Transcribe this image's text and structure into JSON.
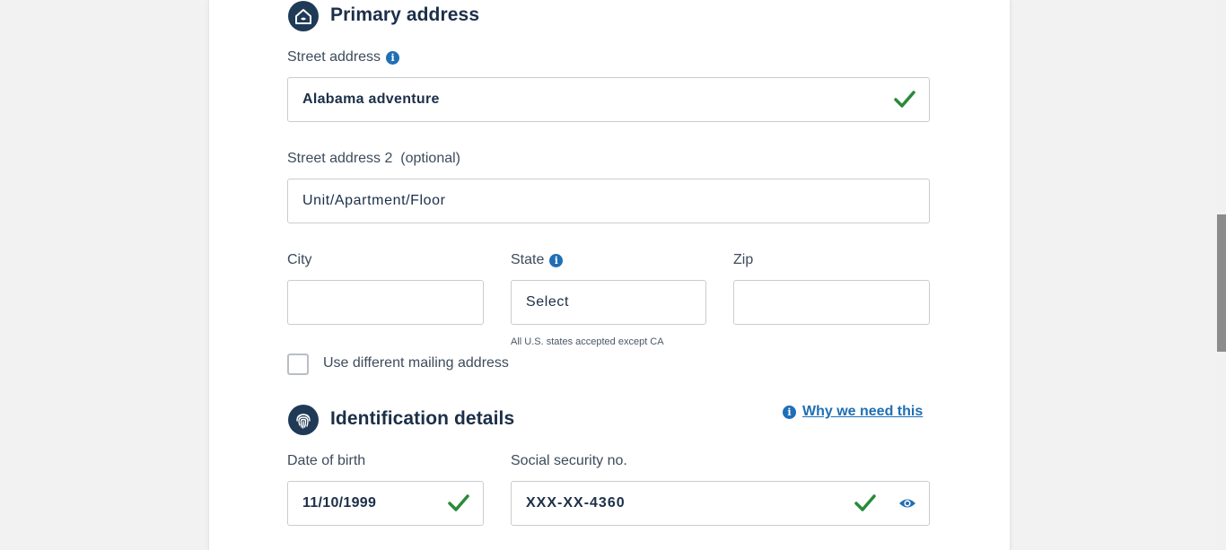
{
  "primary_address": {
    "title": "Primary address",
    "icon": "house-icon",
    "street_label": "Street address",
    "street_value": "Alabama adventure",
    "street2_label": "Street address 2  (optional)",
    "street2_placeholder": "Unit/Apartment/Floor",
    "city_label": "City",
    "city_value": "",
    "state_label": "State",
    "state_value": "Select",
    "state_helper": "All U.S. states accepted except CA",
    "zip_label": "Zip",
    "zip_value": "",
    "mailing_checkbox_label": "Use different mailing address",
    "mailing_checked": false
  },
  "identification": {
    "title": "Identification details",
    "icon": "fingerprint-icon",
    "why_link": "Why we need this",
    "dob_label": "Date of birth",
    "dob_value": "11/10/1999",
    "ssn_label": "Social security no.",
    "ssn_value": "XXX-XX-4360"
  },
  "colors": {
    "valid_check": "#2a8a3a",
    "accent_blue": "#1f6fb5",
    "heading_navy": "#1b2f48"
  }
}
